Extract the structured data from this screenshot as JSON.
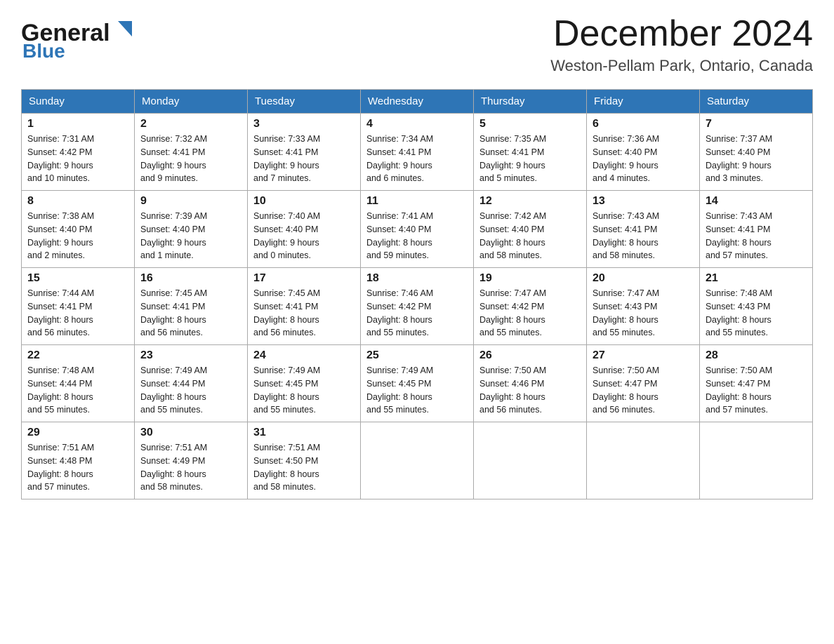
{
  "header": {
    "logo_general": "General",
    "logo_blue": "Blue",
    "month_title": "December 2024",
    "location": "Weston-Pellam Park, Ontario, Canada"
  },
  "weekdays": [
    "Sunday",
    "Monday",
    "Tuesday",
    "Wednesday",
    "Thursday",
    "Friday",
    "Saturday"
  ],
  "weeks": [
    [
      {
        "day": "1",
        "sunrise": "7:31 AM",
        "sunset": "4:42 PM",
        "daylight": "9 hours and 10 minutes."
      },
      {
        "day": "2",
        "sunrise": "7:32 AM",
        "sunset": "4:41 PM",
        "daylight": "9 hours and 9 minutes."
      },
      {
        "day": "3",
        "sunrise": "7:33 AM",
        "sunset": "4:41 PM",
        "daylight": "9 hours and 7 minutes."
      },
      {
        "day": "4",
        "sunrise": "7:34 AM",
        "sunset": "4:41 PM",
        "daylight": "9 hours and 6 minutes."
      },
      {
        "day": "5",
        "sunrise": "7:35 AM",
        "sunset": "4:41 PM",
        "daylight": "9 hours and 5 minutes."
      },
      {
        "day": "6",
        "sunrise": "7:36 AM",
        "sunset": "4:40 PM",
        "daylight": "9 hours and 4 minutes."
      },
      {
        "day": "7",
        "sunrise": "7:37 AM",
        "sunset": "4:40 PM",
        "daylight": "9 hours and 3 minutes."
      }
    ],
    [
      {
        "day": "8",
        "sunrise": "7:38 AM",
        "sunset": "4:40 PM",
        "daylight": "9 hours and 2 minutes."
      },
      {
        "day": "9",
        "sunrise": "7:39 AM",
        "sunset": "4:40 PM",
        "daylight": "9 hours and 1 minute."
      },
      {
        "day": "10",
        "sunrise": "7:40 AM",
        "sunset": "4:40 PM",
        "daylight": "9 hours and 0 minutes."
      },
      {
        "day": "11",
        "sunrise": "7:41 AM",
        "sunset": "4:40 PM",
        "daylight": "8 hours and 59 minutes."
      },
      {
        "day": "12",
        "sunrise": "7:42 AM",
        "sunset": "4:40 PM",
        "daylight": "8 hours and 58 minutes."
      },
      {
        "day": "13",
        "sunrise": "7:43 AM",
        "sunset": "4:41 PM",
        "daylight": "8 hours and 58 minutes."
      },
      {
        "day": "14",
        "sunrise": "7:43 AM",
        "sunset": "4:41 PM",
        "daylight": "8 hours and 57 minutes."
      }
    ],
    [
      {
        "day": "15",
        "sunrise": "7:44 AM",
        "sunset": "4:41 PM",
        "daylight": "8 hours and 56 minutes."
      },
      {
        "day": "16",
        "sunrise": "7:45 AM",
        "sunset": "4:41 PM",
        "daylight": "8 hours and 56 minutes."
      },
      {
        "day": "17",
        "sunrise": "7:45 AM",
        "sunset": "4:41 PM",
        "daylight": "8 hours and 56 minutes."
      },
      {
        "day": "18",
        "sunrise": "7:46 AM",
        "sunset": "4:42 PM",
        "daylight": "8 hours and 55 minutes."
      },
      {
        "day": "19",
        "sunrise": "7:47 AM",
        "sunset": "4:42 PM",
        "daylight": "8 hours and 55 minutes."
      },
      {
        "day": "20",
        "sunrise": "7:47 AM",
        "sunset": "4:43 PM",
        "daylight": "8 hours and 55 minutes."
      },
      {
        "day": "21",
        "sunrise": "7:48 AM",
        "sunset": "4:43 PM",
        "daylight": "8 hours and 55 minutes."
      }
    ],
    [
      {
        "day": "22",
        "sunrise": "7:48 AM",
        "sunset": "4:44 PM",
        "daylight": "8 hours and 55 minutes."
      },
      {
        "day": "23",
        "sunrise": "7:49 AM",
        "sunset": "4:44 PM",
        "daylight": "8 hours and 55 minutes."
      },
      {
        "day": "24",
        "sunrise": "7:49 AM",
        "sunset": "4:45 PM",
        "daylight": "8 hours and 55 minutes."
      },
      {
        "day": "25",
        "sunrise": "7:49 AM",
        "sunset": "4:45 PM",
        "daylight": "8 hours and 55 minutes."
      },
      {
        "day": "26",
        "sunrise": "7:50 AM",
        "sunset": "4:46 PM",
        "daylight": "8 hours and 56 minutes."
      },
      {
        "day": "27",
        "sunrise": "7:50 AM",
        "sunset": "4:47 PM",
        "daylight": "8 hours and 56 minutes."
      },
      {
        "day": "28",
        "sunrise": "7:50 AM",
        "sunset": "4:47 PM",
        "daylight": "8 hours and 57 minutes."
      }
    ],
    [
      {
        "day": "29",
        "sunrise": "7:51 AM",
        "sunset": "4:48 PM",
        "daylight": "8 hours and 57 minutes."
      },
      {
        "day": "30",
        "sunrise": "7:51 AM",
        "sunset": "4:49 PM",
        "daylight": "8 hours and 58 minutes."
      },
      {
        "day": "31",
        "sunrise": "7:51 AM",
        "sunset": "4:50 PM",
        "daylight": "8 hours and 58 minutes."
      },
      null,
      null,
      null,
      null
    ]
  ],
  "labels": {
    "sunrise": "Sunrise:",
    "sunset": "Sunset:",
    "daylight": "Daylight:"
  }
}
